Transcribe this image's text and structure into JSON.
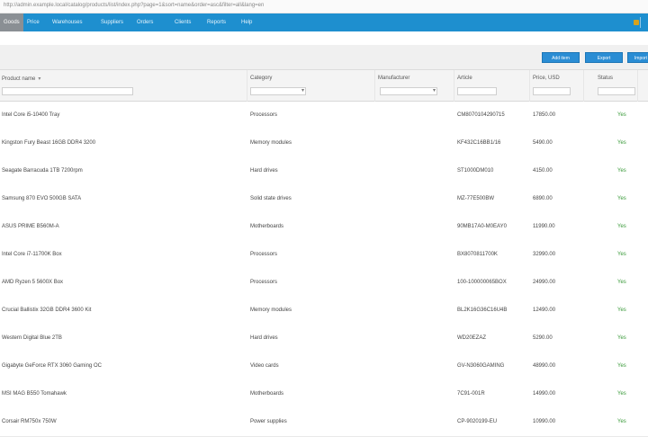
{
  "browser": {
    "url": "http://admin.example.local/catalog/products/list/index.php?page=1&sort=name&order=asc&filter=all&lang=en"
  },
  "nav": {
    "items": [
      "Goods",
      "Price",
      "Warehouses",
      "Suppliers",
      "Orders",
      "Clients",
      "Reports",
      "Help"
    ]
  },
  "toolbar": {
    "buttons": [
      "Add item",
      "Export",
      "Import"
    ]
  },
  "table": {
    "columns": [
      "Product name",
      "Category",
      "Manufacturer",
      "Article",
      "Price, USD",
      "Status"
    ],
    "rows": [
      {
        "name": "Intel Core i5-10400 Tray",
        "category": "Processors",
        "manufacturer": "",
        "article": "CM8070104290715",
        "price": "17850.00",
        "status": "Yes"
      },
      {
        "name": "Kingston Fury Beast 16GB DDR4 3200",
        "category": "Memory modules",
        "manufacturer": "",
        "article": "KF432C16BB1/16",
        "price": "5490.00",
        "status": "Yes"
      },
      {
        "name": "Seagate Barracuda 1TB 7200rpm",
        "category": "Hard drives",
        "manufacturer": "",
        "article": "ST1000DM010",
        "price": "4150.00",
        "status": "Yes"
      },
      {
        "name": "Samsung 870 EVO 500GB SATA",
        "category": "Solid state drives",
        "manufacturer": "",
        "article": "MZ-77E500BW",
        "price": "6890.00",
        "status": "Yes"
      },
      {
        "name": "ASUS PRIME B560M-A",
        "category": "Motherboards",
        "manufacturer": "",
        "article": "90MB17A0-M0EAY0",
        "price": "11990.00",
        "status": "Yes"
      },
      {
        "name": "Intel Core i7-11700K Box",
        "category": "Processors",
        "manufacturer": "",
        "article": "BX8070811700K",
        "price": "32990.00",
        "status": "Yes"
      },
      {
        "name": "AMD Ryzen 5 5600X Box",
        "category": "Processors",
        "manufacturer": "",
        "article": "100-100000065BOX",
        "price": "24990.00",
        "status": "Yes"
      },
      {
        "name": "Crucial Ballistix 32GB DDR4 3600 Kit",
        "category": "Memory modules",
        "manufacturer": "",
        "article": "BL2K16G36C16U4B",
        "price": "12490.00",
        "status": "Yes"
      },
      {
        "name": "Western Digital Blue 2TB",
        "category": "Hard drives",
        "manufacturer": "",
        "article": "WD20EZAZ",
        "price": "5290.00",
        "status": "Yes"
      },
      {
        "name": "Gigabyte GeForce RTX 3060 Gaming OC",
        "category": "Video cards",
        "manufacturer": "",
        "article": "GV-N3060GAMING",
        "price": "48990.00",
        "status": "Yes"
      },
      {
        "name": "MSI MAG B550 Tomahawk",
        "category": "Motherboards",
        "manufacturer": "",
        "article": "7C91-001R",
        "price": "14990.00",
        "status": "Yes"
      },
      {
        "name": "Corsair RM750x 750W",
        "category": "Power supplies",
        "manufacturer": "",
        "article": "CP-9020199-EU",
        "price": "10990.00",
        "status": "Yes"
      }
    ]
  }
}
